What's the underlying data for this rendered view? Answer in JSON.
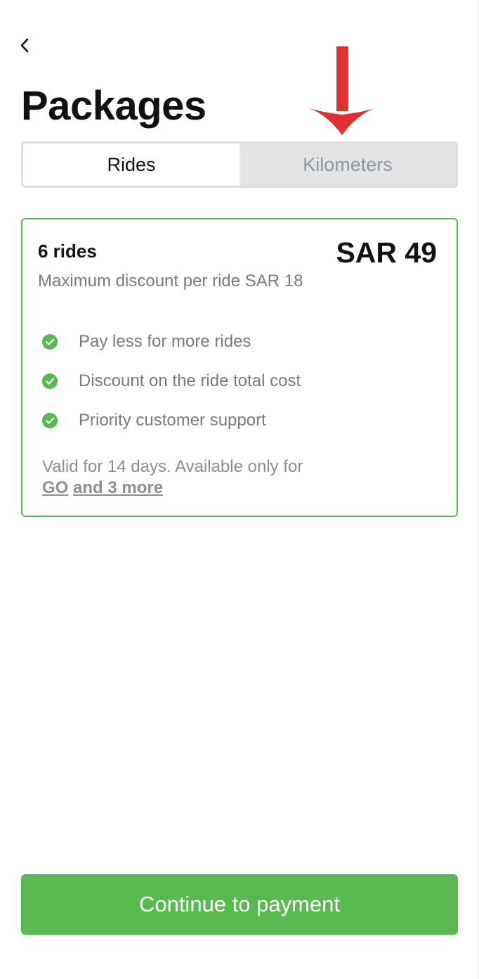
{
  "header": {
    "title": "Packages",
    "back_icon": "chevron-left-icon"
  },
  "annotation": {
    "arrow_icon": "red-arrow-down-icon",
    "arrow_color": "#e03030"
  },
  "tabs": [
    {
      "label": "Rides",
      "active": true
    },
    {
      "label": "Kilometers",
      "active": false
    }
  ],
  "package": {
    "title": "6 rides",
    "price": "SAR 49",
    "subtitle": "Maximum discount per ride SAR 18",
    "features": [
      "Pay less for more rides",
      "Discount on the ride total cost",
      "Priority customer support"
    ],
    "check_icon": "check-circle-icon",
    "check_color": "#57b94f",
    "validity_text": "Valid for 14 days. Available only for",
    "link_go": "GO",
    "link_more": "and 3 more"
  },
  "footer": {
    "continue_label": "Continue to payment",
    "button_color": "#57b94f"
  }
}
